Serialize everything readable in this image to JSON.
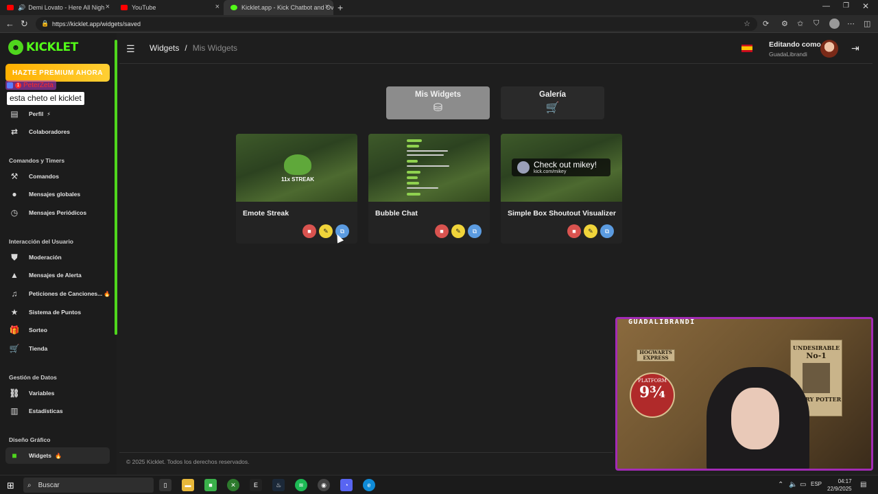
{
  "browser": {
    "tabs": [
      {
        "label": "Demi Lovato - Here All Nigh",
        "icon": "youtube-icon",
        "audio": true
      },
      {
        "label": "YouTube",
        "icon": "youtube-icon"
      },
      {
        "label": "Kicklet.app - Kick Chatbot and Ov",
        "icon": "kicklet-icon",
        "active": true
      }
    ],
    "url": "https://kicklet.app/widgets/saved"
  },
  "sidebar": {
    "logo": "KICKLET",
    "premium_label": "HAZTE PREMIUM AHORA",
    "sections": [
      {
        "title": "",
        "items": [
          {
            "label": "Perfil",
            "icon": "profile-icon",
            "tag": "⚡"
          },
          {
            "label": "Colaboradores",
            "icon": "collaborators-icon"
          }
        ]
      },
      {
        "title": "Comandos y Timers",
        "items": [
          {
            "label": "Comandos",
            "icon": "hammer-icon"
          },
          {
            "label": "Mensajes globales",
            "icon": "chat-bubble-icon"
          },
          {
            "label": "Mensajes Periódicos",
            "icon": "clock-icon"
          }
        ]
      },
      {
        "title": "Interacción del Usuario",
        "items": [
          {
            "label": "Moderación",
            "icon": "shield-icon"
          },
          {
            "label": "Mensajes de Alerta",
            "icon": "warning-icon"
          },
          {
            "label": "Peticiones de Canciones...",
            "icon": "music-icon",
            "tag": "🔥"
          },
          {
            "label": "Sistema de Puntos",
            "icon": "star-icon"
          },
          {
            "label": "Sorteo",
            "icon": "gift-icon"
          },
          {
            "label": "Tienda",
            "icon": "cart-icon"
          }
        ]
      },
      {
        "title": "Gestión de Datos",
        "items": [
          {
            "label": "Variables",
            "icon": "link-icon"
          },
          {
            "label": "Estadísticas",
            "icon": "chart-icon"
          }
        ]
      },
      {
        "title": "Diseño Gráfico",
        "items": [
          {
            "label": "Widgets",
            "icon": "video-icon",
            "tag": "🔥",
            "active": true
          }
        ]
      }
    ]
  },
  "chat_overlay": {
    "username": "PeterZeta",
    "message": "esta cheto el kicklet"
  },
  "header": {
    "breadcrumb": [
      "Widgets",
      "/",
      "Mis Widgets"
    ],
    "edit_label": "Editando como",
    "edit_user": "GuadaLibrandi",
    "flag": "spain-flag-icon"
  },
  "widget_tabs": [
    {
      "label": "Mis Widgets",
      "icon": "database-icon",
      "active": true
    },
    {
      "label": "Galería",
      "icon": "cart-icon",
      "active": false
    }
  ],
  "cards": [
    {
      "title": "Emote Streak",
      "thumb_text": "11x STREAK"
    },
    {
      "title": "Bubble Chat",
      "thumb_text": ""
    },
    {
      "title": "Simple Box Shoutout Visualizer",
      "thumb_text": "Check out mikey!",
      "thumb_sub": "kick.com/mikey"
    }
  ],
  "footer": "© 2025 Kicklet. Todos los derechos reservados.",
  "webcam": {
    "name": "GUADALIBRANDI",
    "poster_1": "HOGWARTS EXPRESS",
    "poster_2": "PLATFORM",
    "poster_num": "9¾",
    "poster_3": "UNDESIRABLE",
    "poster_4": "No-1",
    "poster_5": "HARRY POTTER"
  },
  "taskbar": {
    "search_label": "Buscar",
    "lang": "ESP",
    "time": "04:17",
    "date": "22/9/2025"
  },
  "colors": {
    "accent": "#53fc18",
    "premium": "#ffb000",
    "cam_border": "#a22bb5"
  }
}
